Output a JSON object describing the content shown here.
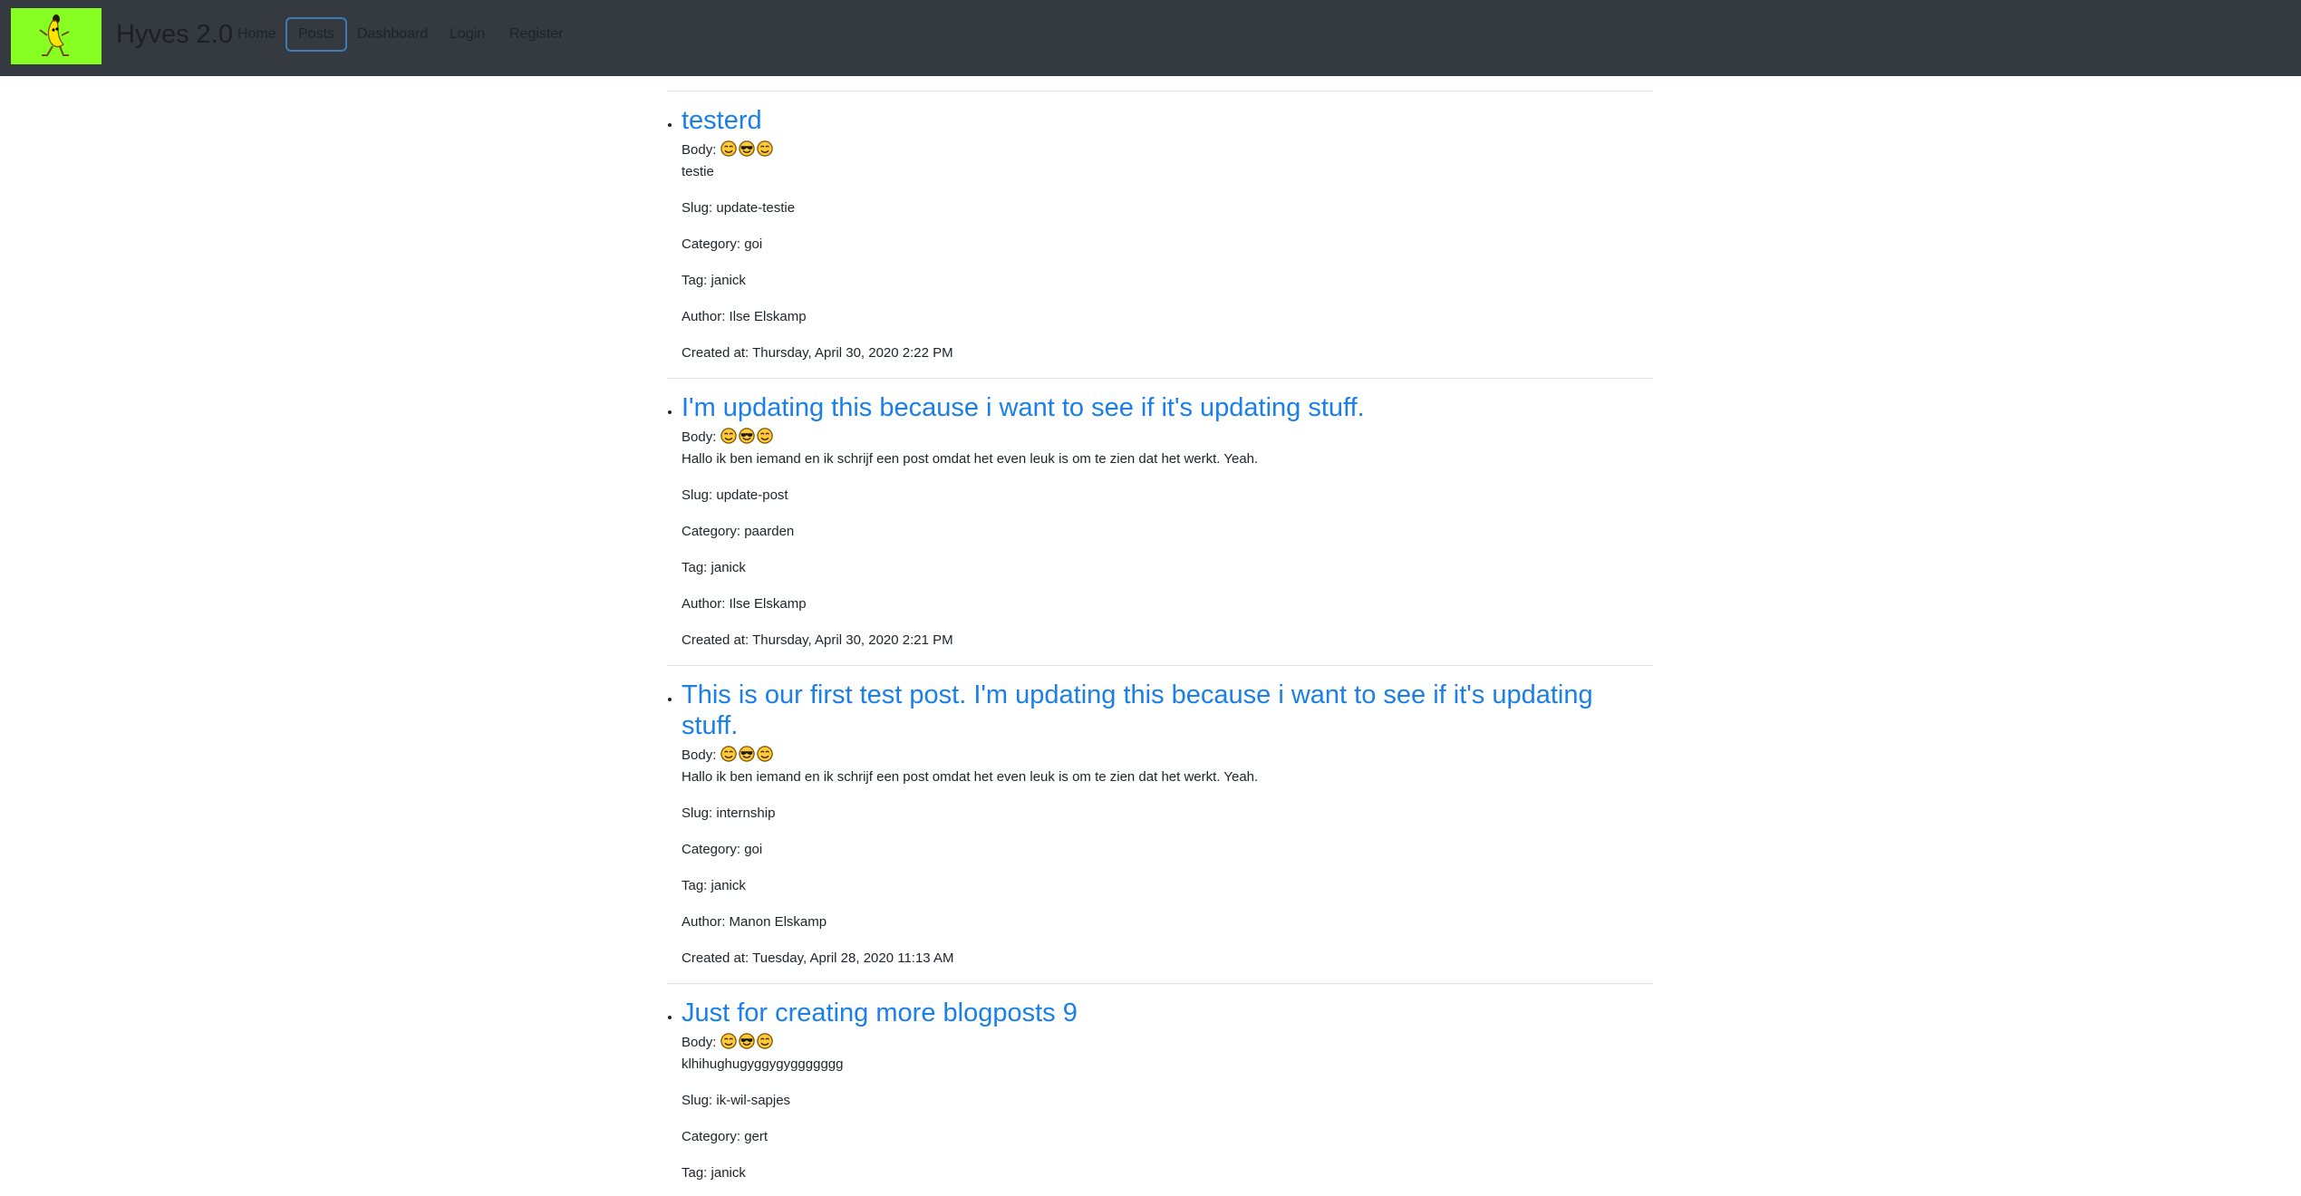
{
  "navbar": {
    "brand": "Hyves 2.0",
    "links": [
      {
        "label": "Home",
        "active": false
      },
      {
        "label": "Posts",
        "active": true
      },
      {
        "label": "Dashboard",
        "active": false
      },
      {
        "label": "Login",
        "active": false
      },
      {
        "label": "Register",
        "active": false
      }
    ],
    "logo_color": "#88ff22",
    "background": "#343a40"
  },
  "labels": {
    "body": "Body:",
    "slug": "Slug:",
    "category": "Category:",
    "tag": "Tag:",
    "author": "Author:",
    "created": "Created at:"
  },
  "emoji_icons": [
    "smiling-face-icon",
    "sunglasses-face-icon",
    "smiling-face-icon"
  ],
  "posts": [
    {
      "title": "testerd",
      "body": "testie",
      "slug": "update-testie",
      "category": "goi",
      "tag": "janick",
      "author": "Ilse Elskamp",
      "created_at": "Thursday, April 30, 2020 2:22 PM"
    },
    {
      "title": "I'm updating this because i want to see if it's updating stuff.",
      "body": "Hallo ik ben iemand en ik schrijf een post omdat het even leuk is om te zien dat het werkt. Yeah.",
      "slug": "update-post",
      "category": "paarden",
      "tag": "janick",
      "author": "Ilse Elskamp",
      "created_at": "Thursday, April 30, 2020 2:21 PM"
    },
    {
      "title": "This is our first test post. I'm updating this because i want to see if it's updating stuff.",
      "body": "Hallo ik ben iemand en ik schrijf een post omdat het even leuk is om te zien dat het werkt. Yeah.",
      "slug": "internship",
      "category": "goi",
      "tag": "janick",
      "author": "Manon Elskamp",
      "created_at": "Tuesday, April 28, 2020 11:13 AM"
    },
    {
      "title": "Just for creating more blogposts 9",
      "body": "klhihughugyggygyggggggg",
      "slug": "ik-wil-sapjes",
      "category": "gert",
      "tag": "janick",
      "author": "",
      "created_at": ""
    }
  ],
  "colors": {
    "link": "#1a7fe8",
    "text": "#212529",
    "rule": "#e2e2e2",
    "active_border": "#3d7bb5"
  }
}
